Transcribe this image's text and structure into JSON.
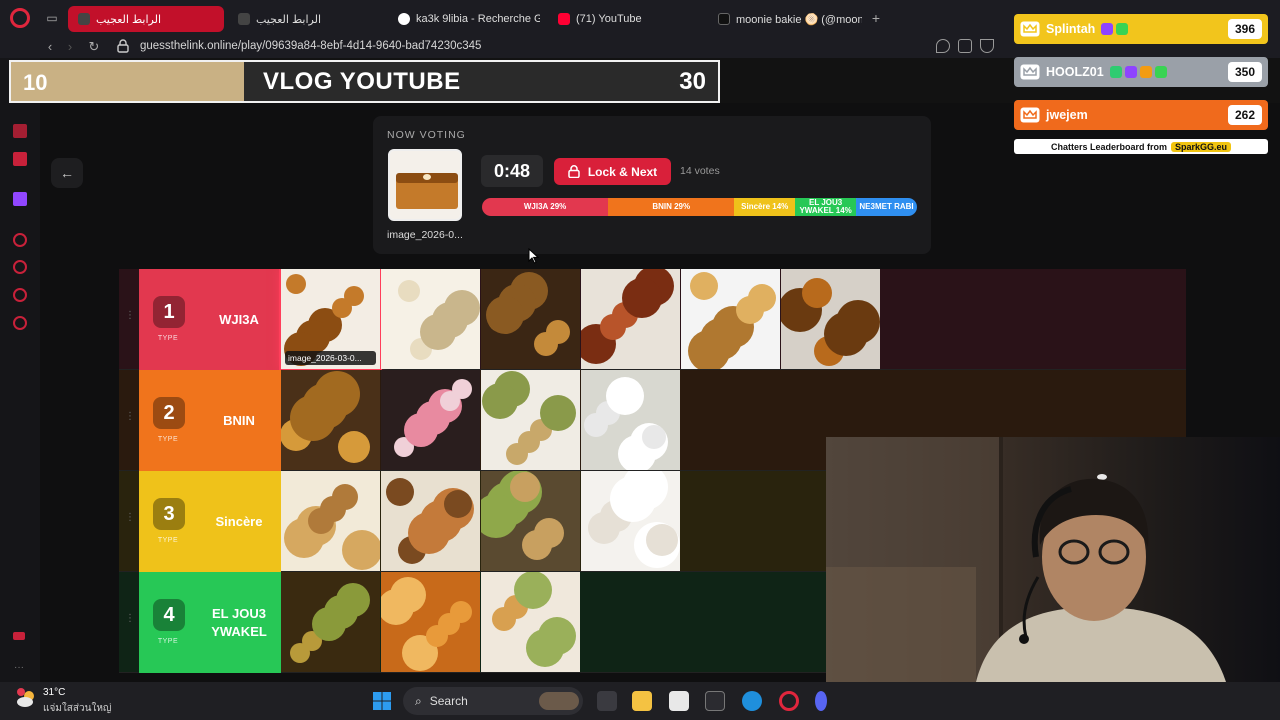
{
  "browser": {
    "tabs": [
      {
        "label": "الرابط العجيب",
        "active": true
      },
      {
        "label": "الرابط العجيب",
        "active": false
      },
      {
        "label": "ka3k 9libia - Recherche G",
        "active": false
      },
      {
        "label": "(71) YouTube",
        "active": false
      },
      {
        "label": "moonie bakie 🫓 (@moonie",
        "active": false
      }
    ],
    "url": "guessthelink.online/play/09639a84-8ebf-4d14-9640-bad74230c345"
  },
  "banner": {
    "left_score": "10",
    "title": "VLOG YOUTUBE",
    "right_score": "30",
    "progress": 0.33
  },
  "voting": {
    "label": "NOW VOTING",
    "image_name": "image_2026-0...",
    "timer": "0:48",
    "lock_button": "Lock & Next",
    "votes": "14 votes",
    "segments": [
      {
        "label": "WJI3A 29%",
        "share": 29,
        "color": "#e2384f"
      },
      {
        "label": "BNIN 29%",
        "share": 29,
        "color": "#f0741c"
      },
      {
        "label": "Sincère 14%",
        "share": 14,
        "color": "#efc21a"
      },
      {
        "label": "EL JOU3 YWAKEL 14%",
        "share": 14,
        "color": "#27c856"
      },
      {
        "label": "NE3MET RABI",
        "share": 14,
        "color": "#2f8ff0"
      }
    ]
  },
  "tiers": [
    {
      "number": "1",
      "type": "TYPE",
      "name": "WJI3A",
      "color": "#e2384f",
      "bg": "#2a1218",
      "items": 6,
      "first_caption": "image_2026-03-0..."
    },
    {
      "number": "2",
      "type": "TYPE",
      "name": "BNIN",
      "color": "#f0741c",
      "bg": "#2a1a0e",
      "items": 4
    },
    {
      "number": "3",
      "type": "TYPE",
      "name": "Sincère",
      "color": "#efc21a",
      "bg": "#29230d",
      "items": 4
    },
    {
      "number": "4",
      "type": "TYPE",
      "name": "EL JOU3 YWAKEL",
      "color": "#27c856",
      "bg": "#0f2416",
      "items": 3
    }
  ],
  "leaderboard": {
    "rows": [
      {
        "name": "Splintah",
        "score": "396",
        "color": "#f2c51c",
        "badges": [
          "#8e44ff",
          "#39d353"
        ]
      },
      {
        "name": "HOOLZ01",
        "score": "350",
        "color": "#9aa0a8",
        "badges": [
          "#2ecc71",
          "#8e44ff",
          "#f39c12",
          "#39d353"
        ]
      },
      {
        "name": "jwejem",
        "score": "262",
        "color": "#f06a1c",
        "badges": []
      }
    ],
    "footer": "Chatters Leaderboard from",
    "brand": "SparkGG.eu"
  },
  "taskbar": {
    "temperature": "31°C",
    "weather_desc": "แจ่มใสส่วนใหญ่",
    "search": "Search"
  }
}
